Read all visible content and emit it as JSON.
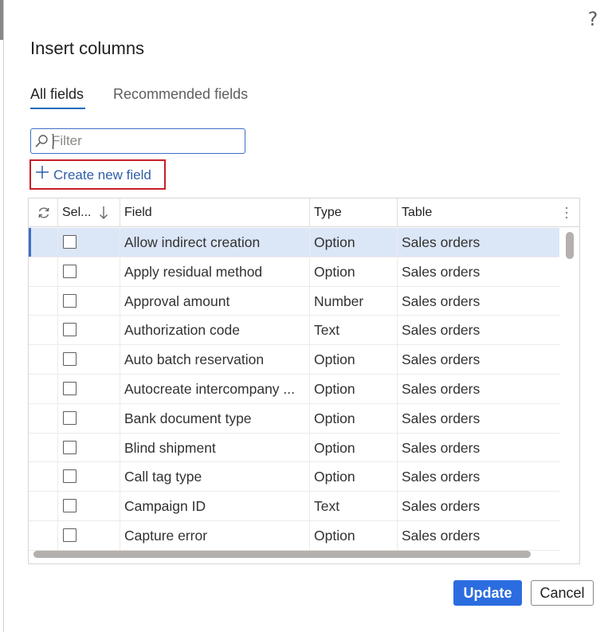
{
  "dialog": {
    "help_glyph": "?",
    "title": "Insert columns"
  },
  "tabs": [
    {
      "label": "All fields",
      "active": true
    },
    {
      "label": "Recommended fields",
      "active": false
    }
  ],
  "filter": {
    "placeholder": "Filter",
    "value": ""
  },
  "create_field": {
    "label": "Create new field",
    "icon": "plus-icon"
  },
  "grid": {
    "columns": {
      "refresh_icon": "refresh-icon",
      "selected": "Sel...",
      "sort_icon": "arrow-down-icon",
      "field": "Field",
      "type": "Type",
      "table": "Table",
      "more_icon": "more-vertical-icon"
    },
    "rows": [
      {
        "field": "Allow indirect creation",
        "type": "Option",
        "table": "Sales orders",
        "checked": false,
        "selected": true
      },
      {
        "field": "Apply residual method",
        "type": "Option",
        "table": "Sales orders",
        "checked": false,
        "selected": false
      },
      {
        "field": "Approval amount",
        "type": "Number",
        "table": "Sales orders",
        "checked": false,
        "selected": false
      },
      {
        "field": "Authorization code",
        "type": "Text",
        "table": "Sales orders",
        "checked": false,
        "selected": false
      },
      {
        "field": "Auto batch reservation",
        "type": "Option",
        "table": "Sales orders",
        "checked": false,
        "selected": false
      },
      {
        "field": "Autocreate intercompany ...",
        "type": "Option",
        "table": "Sales orders",
        "checked": false,
        "selected": false
      },
      {
        "field": "Bank document type",
        "type": "Option",
        "table": "Sales orders",
        "checked": false,
        "selected": false
      },
      {
        "field": "Blind shipment",
        "type": "Option",
        "table": "Sales orders",
        "checked": false,
        "selected": false
      },
      {
        "field": "Call tag type",
        "type": "Option",
        "table": "Sales orders",
        "checked": false,
        "selected": false
      },
      {
        "field": "Campaign ID",
        "type": "Text",
        "table": "Sales orders",
        "checked": false,
        "selected": false
      },
      {
        "field": "Capture error",
        "type": "Option",
        "table": "Sales orders",
        "checked": false,
        "selected": false
      }
    ]
  },
  "buttons": {
    "update": "Update",
    "cancel": "Cancel"
  },
  "colors": {
    "accent": "#2b6de0",
    "link": "#2e5ea8",
    "highlight_border": "#c81e28",
    "selected_row": "#dbe6f7"
  }
}
